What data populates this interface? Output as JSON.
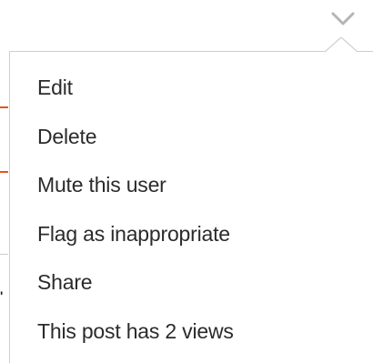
{
  "dropdown": {
    "trigger_icon": "chevron-down-icon",
    "items": [
      {
        "label": "Edit"
      },
      {
        "label": "Delete"
      },
      {
        "label": "Mute this user"
      },
      {
        "label": "Flag as inappropriate"
      },
      {
        "label": "Share"
      },
      {
        "label": "This post has 2 views"
      }
    ]
  },
  "colors": {
    "accent": "#e8541e",
    "text": "#2b2b2b",
    "border": "#cfcfcf",
    "chevron": "#b5b5b5"
  }
}
